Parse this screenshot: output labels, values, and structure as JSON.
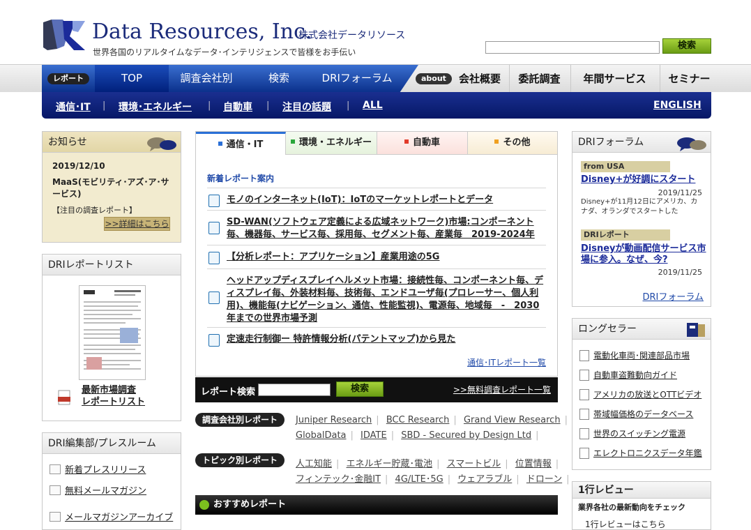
{
  "header": {
    "brand_name": "Data Resources, Inc.",
    "brand_jp": "株式会社データリソース",
    "tagline": "世界各国のリアルタイムなデータ･インテリジェンスで皆様をお手伝い",
    "search_button": "検索"
  },
  "nav": {
    "report_pill": "レポート",
    "tabs": [
      {
        "label": "TOP"
      },
      {
        "label": "調査会社別"
      },
      {
        "label": "検索"
      },
      {
        "label": "DRIフォーラム"
      }
    ],
    "about_pill": "about",
    "right_items": [
      {
        "label": "会社概要"
      },
      {
        "label": "委託調査"
      },
      {
        "label": "年間サービス"
      },
      {
        "label": "セミナー"
      }
    ]
  },
  "subnav": {
    "items": [
      {
        "label": "通信･IT"
      },
      {
        "label": "環境･エネルギー"
      },
      {
        "label": "自動車"
      },
      {
        "label": "注目の話題"
      },
      {
        "label": "ALL"
      }
    ],
    "english": "ENGLISH"
  },
  "news": {
    "title": "お知らせ",
    "date": "2019/12/10",
    "headline": "MaaS(モビリティ･アズ･ア･サービス)",
    "tag": "【注目の調査レポート】",
    "more": ">>詳細はこちら"
  },
  "dri_list": {
    "title": "DRIレポートリスト",
    "link": "最新市場調査\nレポートリスト",
    "link_line1": "最新市場調査",
    "link_line2": "レポートリスト"
  },
  "press": {
    "title": "DRI編集部/プレスルーム",
    "items": [
      {
        "label": "新着プレスリリース"
      },
      {
        "label": "無料メールマガジン"
      },
      {
        "label": "メールマガジンアーカイブ"
      }
    ]
  },
  "center": {
    "tabs": [
      {
        "label": "通信・IT",
        "color": "#2a6fd6"
      },
      {
        "label": "環境・エネルギー",
        "color": "#2aa63a"
      },
      {
        "label": "自動車",
        "color": "#e23a2a"
      },
      {
        "label": "その他",
        "color": "#f0a020"
      }
    ],
    "heading": "新着レポート案内",
    "reports": [
      {
        "text": "モノのインターネット(IoT)：IoTのマーケットレポートとデータ"
      },
      {
        "text": "SD-WAN(ソフトウェア定義による広域ネットワーク)市場:コンポーネント毎、機器毎、サービス毎、採用毎、セグメント毎、産業毎　2019-2024年"
      },
      {
        "text": "【分析レポート：アプリケーション】産業用途の5G"
      },
      {
        "text": "ヘッドアップディスプレイヘルメット市場：接続性毎、コンポーネント毎、ディスプレイ毎、外装材料毎、技術毎、エンドユーザ毎(プロレーサー、個人利用)、機能毎(ナビゲーション、通信、性能監視)、電源毎、地域毎　-　2030年までの世界市場予測"
      },
      {
        "text": "定速走行制御ー 特許情報分析(パテントマップ)から見た"
      }
    ],
    "more": "通信･ITレポート一覧"
  },
  "report_search": {
    "label": "レポート検索",
    "button": "検索",
    "free_link": ">>無料調査レポート一覧"
  },
  "by_company": {
    "label": "調査会社別レポート",
    "row1": [
      "Juniper Research",
      "BCC Research",
      "Grand View Research"
    ],
    "row2": [
      "GlobalData",
      "IDATE",
      "SBD - Secured by Design Ltd"
    ]
  },
  "by_topic": {
    "label": "トピック別レポート",
    "row1": [
      "人工知能",
      "エネルギー貯蔵･電池",
      "スマートビル",
      "位置情報"
    ],
    "row2": [
      "フィンテック･金融IT",
      "4G/LTE･5G",
      "ウェアラブル",
      "ドローン"
    ]
  },
  "recommend": {
    "label": "おすすめレポート"
  },
  "forum": {
    "title": "DRIフォーラム",
    "entries": [
      {
        "tag": "from USA",
        "link": "Disney+が好調にスタート",
        "date": "2019/11/25",
        "desc": "Disney+が11月12日にアメリカ、カナダ、オランダでスタートした"
      },
      {
        "tag": "DRIレポート",
        "link": "Disneyが動画配信サービス市場に参入。なぜ、今?",
        "date": "2019/11/25"
      }
    ],
    "more": "DRIフォーラム"
  },
  "longseller": {
    "title": "ロングセラー",
    "items": [
      {
        "label": "電動化車両･関連部品市場"
      },
      {
        "label": "自動車盗難動向ガイド"
      },
      {
        "label": "アメリカの放送とOTTビデオ"
      },
      {
        "label": "帯域幅価格のデータベース"
      },
      {
        "label": "世界のスイッチング電源"
      },
      {
        "label": "エレクトロニクスデータ年鑑"
      }
    ]
  },
  "review": {
    "title": "1行レビュー",
    "subtitle": "業界各社の最新動向をチェック",
    "item": "1行レビューはこちら"
  },
  "colors": {
    "brand_navy": "#1b2b7a",
    "nav_blue": "#0a2f8a",
    "button_green": "#7cb21e"
  }
}
